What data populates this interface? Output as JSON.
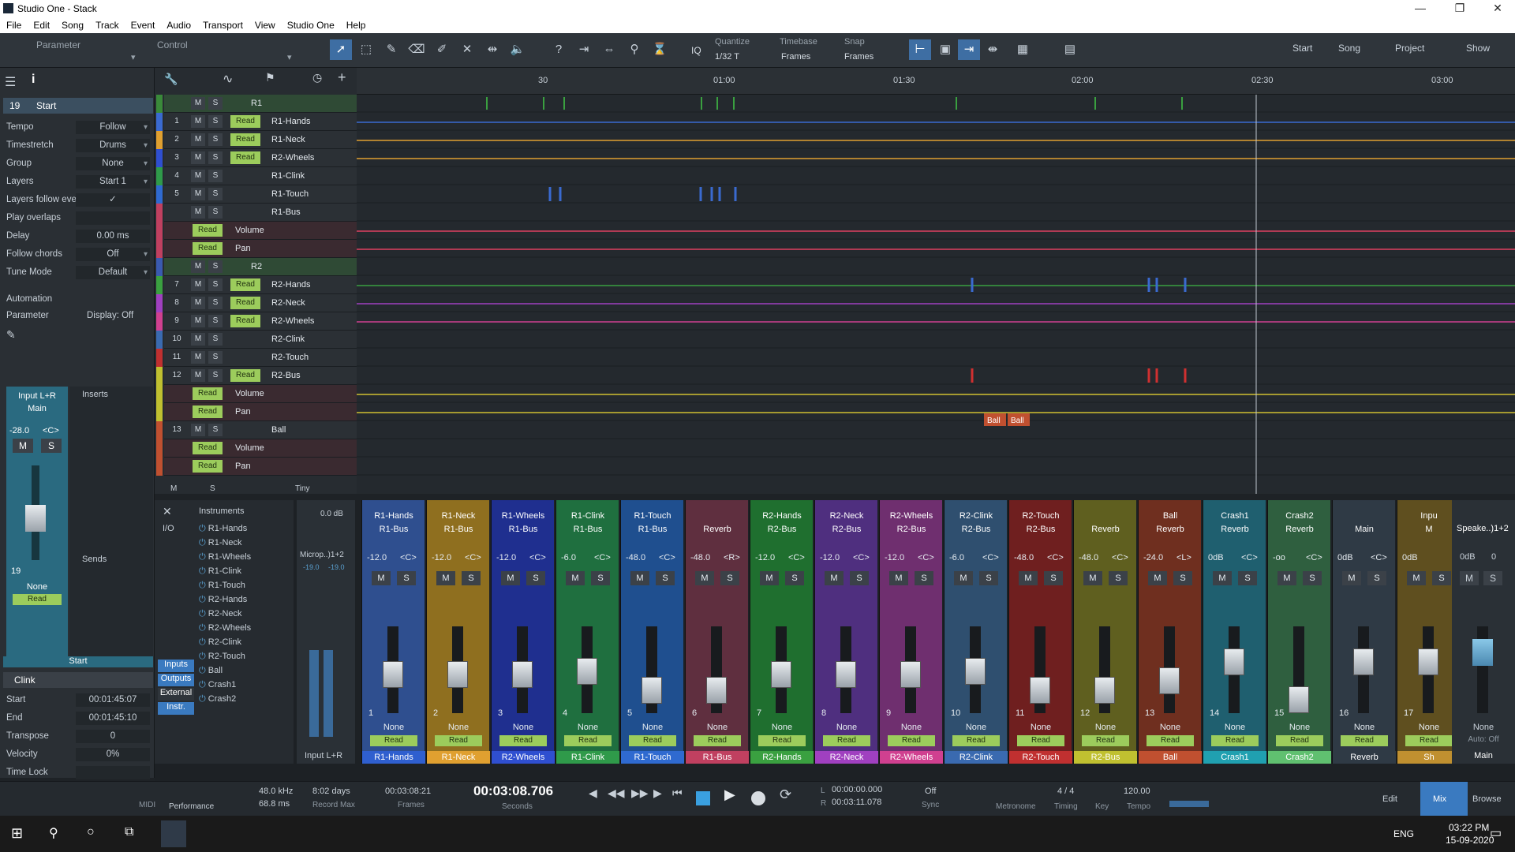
{
  "window": {
    "title": "Studio One - Stack"
  },
  "menu": [
    "File",
    "Edit",
    "Song",
    "Track",
    "Event",
    "Audio",
    "Transport",
    "View",
    "Studio One",
    "Help"
  ],
  "toolbar": {
    "parameter": "Parameter",
    "control": "Control",
    "iq": "IQ",
    "quantize_label": "Quantize",
    "quantize_value": "1/32 T",
    "timebase_label": "Timebase",
    "timebase_value": "Frames",
    "snap_label": "Snap",
    "snap_value": "Frames",
    "nav": [
      "Start",
      "Song",
      "Project",
      "Show"
    ]
  },
  "inspector": {
    "track_number": "19",
    "track_name": "Start",
    "rows": [
      {
        "k": "Tempo",
        "v": "Follow"
      },
      {
        "k": "Timestretch",
        "v": "Drums"
      },
      {
        "k": "Group",
        "v": "None"
      },
      {
        "k": "Layers",
        "v": "Start 1"
      },
      {
        "k": "Layers follow events",
        "v": "✓"
      },
      {
        "k": "Play overlaps",
        "v": ""
      },
      {
        "k": "Delay",
        "v": "0.00 ms"
      },
      {
        "k": "Follow chords",
        "v": "Off"
      },
      {
        "k": "Tune Mode",
        "v": "Default"
      }
    ],
    "automation": "Automation",
    "parameter": "Parameter",
    "display": "Display: Off",
    "input": "Input L+R",
    "main": "Main",
    "volume": "-28.0",
    "pan": "<C>",
    "inserts": "Inserts",
    "sends": "Sends",
    "channel_number": "19",
    "none": "None",
    "read": "Read",
    "start": "Start",
    "clip_name": "Clink",
    "clip_rows": [
      {
        "k": "Start",
        "v": "00:01:45:07"
      },
      {
        "k": "End",
        "v": "00:01:45:10"
      },
      {
        "k": "Transpose",
        "v": "0"
      },
      {
        "k": "Velocity",
        "v": "0%"
      },
      {
        "k": "Time Lock",
        "v": ""
      }
    ]
  },
  "tracks": [
    {
      "num": "",
      "name": "R1",
      "read": false,
      "folder": true,
      "color": "#3a8a3a"
    },
    {
      "num": "1",
      "name": "R1-Hands",
      "read": true,
      "color": "#3a6ad0"
    },
    {
      "num": "2",
      "name": "R1-Neck",
      "read": true,
      "color": "#e0a030"
    },
    {
      "num": "3",
      "name": "R2-Wheels",
      "read": true,
      "color": "#2f4fd0"
    },
    {
      "num": "4",
      "name": "R1-Clink",
      "read": false,
      "color": "#2f9a4a"
    },
    {
      "num": "5",
      "name": "R1-Touch",
      "read": false,
      "color": "#2f6ad0"
    },
    {
      "num": "",
      "name": "R1-Bus",
      "read": false,
      "color": "#c04060"
    },
    {
      "num": "",
      "name": "Volume",
      "read": true,
      "color": "#c04060"
    },
    {
      "num": "",
      "name": "Pan",
      "read": true,
      "color": "#c04060"
    },
    {
      "num": "",
      "name": "R2",
      "read": false,
      "folder": true,
      "color": "#3a5ab0"
    },
    {
      "num": "7",
      "name": "R2-Hands",
      "read": true,
      "color": "#3aa040"
    },
    {
      "num": "8",
      "name": "R2-Neck",
      "read": true,
      "color": "#a040c0"
    },
    {
      "num": "9",
      "name": "R2-Wheels",
      "read": true,
      "color": "#d04090"
    },
    {
      "num": "10",
      "name": "R2-Clink",
      "read": false,
      "color": "#3a6ab0"
    },
    {
      "num": "11",
      "name": "R2-Touch",
      "read": false,
      "color": "#c03030"
    },
    {
      "num": "12",
      "name": "R2-Bus",
      "read": true,
      "color": "#c0c030"
    },
    {
      "num": "",
      "name": "Volume",
      "read": true,
      "color": "#c0c030"
    },
    {
      "num": "",
      "name": "Pan",
      "read": true,
      "color": "#c0c030"
    },
    {
      "num": "13",
      "name": "Ball",
      "read": false,
      "color": "#c05030"
    },
    {
      "num": "",
      "name": "Volume",
      "read": true,
      "color": "#c05030"
    },
    {
      "num": "",
      "name": "Pan",
      "read": true,
      "color": "#c05030"
    }
  ],
  "tracklist_footer": {
    "size": "Tiny"
  },
  "ruler": [
    "30",
    "01:00",
    "01:30",
    "02:00",
    "02:30",
    "03:00"
  ],
  "ball_events": [
    "Ball",
    "Ball"
  ],
  "mixer": {
    "instruments_label": "Instruments",
    "io": "I/O",
    "instruments": [
      "R1-Hands",
      "R1-Neck",
      "R1-Wheels",
      "R1-Clink",
      "R1-Touch",
      "R2-Hands",
      "R2-Neck",
      "R2-Wheels",
      "R2-Clink",
      "R2-Touch",
      "Ball",
      "Crash1",
      "Crash2"
    ],
    "side_buttons": [
      "Inputs",
      "Outputs",
      "External",
      "Instr."
    ],
    "input_strip": {
      "level": "0.0 dB",
      "name": "Microp..)1+2",
      "peak_l": "-19.0",
      "peak_r": "-19.0",
      "label": "Input L+R"
    },
    "strips": [
      {
        "n1": "R1-Hands",
        "n2": "R1-Bus",
        "vol": "-12.0",
        "pan": "<C>",
        "ch": "1",
        "label": "R1-Hands",
        "color": "#2f4f8f",
        "lc": "#2f5fcf",
        "fader": 0.45
      },
      {
        "n1": "R1-Neck",
        "n2": "R1-Bus",
        "vol": "-12.0",
        "pan": "<C>",
        "ch": "2",
        "label": "R1-Neck",
        "color": "#8f6f1f",
        "lc": "#e0a030",
        "fader": 0.45
      },
      {
        "n1": "R1-Wheels",
        "n2": "R1-Bus",
        "vol": "-12.0",
        "pan": "<C>",
        "ch": "3",
        "label": "R2-Wheels",
        "color": "#1f2f8f",
        "lc": "#2f4fd0",
        "fader": 0.45
      },
      {
        "n1": "R1-Clink",
        "n2": "R1-Bus",
        "vol": "-6.0",
        "pan": "<C>",
        "ch": "4",
        "label": "R1-Clink",
        "color": "#1f6f3f",
        "lc": "#2f9a4a",
        "fader": 0.5
      },
      {
        "n1": "R1-Touch",
        "n2": "R1-Bus",
        "vol": "-48.0",
        "pan": "<C>",
        "ch": "5",
        "label": "R1-Touch",
        "color": "#1f4f8f",
        "lc": "#2f6ad0",
        "fader": 0.2
      },
      {
        "n1": "",
        "n2": "Reverb",
        "vol": "-48.0",
        "pan": "<R>",
        "ch": "6",
        "label": "R1-Bus",
        "color": "#5f2f3f",
        "lc": "#c04060",
        "fader": 0.2
      },
      {
        "n1": "R2-Hands",
        "n2": "R2-Bus",
        "vol": "-12.0",
        "pan": "<C>",
        "ch": "7",
        "label": "R2-Hands",
        "color": "#1f6f2f",
        "lc": "#3aa040",
        "fader": 0.45
      },
      {
        "n1": "R2-Neck",
        "n2": "R2-Bus",
        "vol": "-12.0",
        "pan": "<C>",
        "ch": "8",
        "label": "R2-Neck",
        "color": "#4f2f7f",
        "lc": "#a040c0",
        "fader": 0.45
      },
      {
        "n1": "R2-Wheels",
        "n2": "R2-Bus",
        "vol": "-12.0",
        "pan": "<C>",
        "ch": "9",
        "label": "R2-Wheels",
        "color": "#6f2f6f",
        "lc": "#d04090",
        "fader": 0.45
      },
      {
        "n1": "R2-Clink",
        "n2": "R2-Bus",
        "vol": "-6.0",
        "pan": "<C>",
        "ch": "10",
        "label": "R2-Clink",
        "color": "#2f4f6f",
        "lc": "#3a6ab0",
        "fader": 0.5
      },
      {
        "n1": "R2-Touch",
        "n2": "R2-Bus",
        "vol": "-48.0",
        "pan": "<C>",
        "ch": "11",
        "label": "R2-Touch",
        "color": "#6f1f1f",
        "lc": "#c03030",
        "fader": 0.2
      },
      {
        "n1": "",
        "n2": "Reverb",
        "vol": "-48.0",
        "pan": "<C>",
        "ch": "12",
        "label": "R2-Bus",
        "color": "#5f5f1f",
        "lc": "#c0c030",
        "fader": 0.2
      },
      {
        "n1": "Ball",
        "n2": "Reverb",
        "vol": "-24.0",
        "pan": "<L>",
        "ch": "13",
        "label": "Ball",
        "color": "#6f2f1f",
        "lc": "#c05030",
        "fader": 0.35
      },
      {
        "n1": "Crash1",
        "n2": "Reverb",
        "vol": "0dB",
        "pan": "<C>",
        "ch": "14",
        "label": "Crash1",
        "color": "#1f5f6f",
        "lc": "#20a0b0",
        "fader": 0.65
      },
      {
        "n1": "Crash2",
        "n2": "Reverb",
        "vol": "-oo",
        "pan": "<C>",
        "ch": "15",
        "label": "Crash2",
        "color": "#2f5f3f",
        "lc": "#60c070",
        "fader": 0.05
      },
      {
        "n1": "",
        "n2": "Main",
        "vol": "0dB",
        "pan": "<C>",
        "ch": "16",
        "label": "Reverb",
        "color": "#2f3a45",
        "lc": "#2f3a45",
        "fader": 0.65
      },
      {
        "n1": "Inpu",
        "n2": "M",
        "vol": "0dB",
        "pan": "",
        "ch": "17",
        "label": "Sh",
        "color": "#5f4f1f",
        "lc": "#c09030",
        "fader": 0.65
      }
    ],
    "main": {
      "name": "Speake..)1+2",
      "vol": "0dB",
      "pan": "0",
      "none": "None",
      "auto": "Auto: Off",
      "label": "Main"
    },
    "common": {
      "none": "None",
      "read": "Read",
      "m": "M",
      "s": "S"
    }
  },
  "transport": {
    "midi": "MIDI",
    "performance": "Performance",
    "rate": "48.0 kHz",
    "latency": "68.8 ms",
    "days": "8:02 days",
    "record_max": "Record Max",
    "frames_time": "00:03:08:21",
    "frames_lbl": "Frames",
    "seconds_time": "00:03:08.706",
    "seconds_lbl": "Seconds",
    "l_time": "00:00:00.000",
    "r_time": "00:03:11.078",
    "sync_val": "Off",
    "sync": "Sync",
    "metronome": "Metronome",
    "timing_val": "4 / 4",
    "timing": "Timing",
    "key": "Key",
    "tempo_val": "120.00",
    "tempo": "Tempo",
    "views": [
      "Edit",
      "Mix",
      "Browse"
    ]
  },
  "taskbar": {
    "lang": "ENG",
    "time": "03:22 PM",
    "date": "15-09-2020"
  }
}
